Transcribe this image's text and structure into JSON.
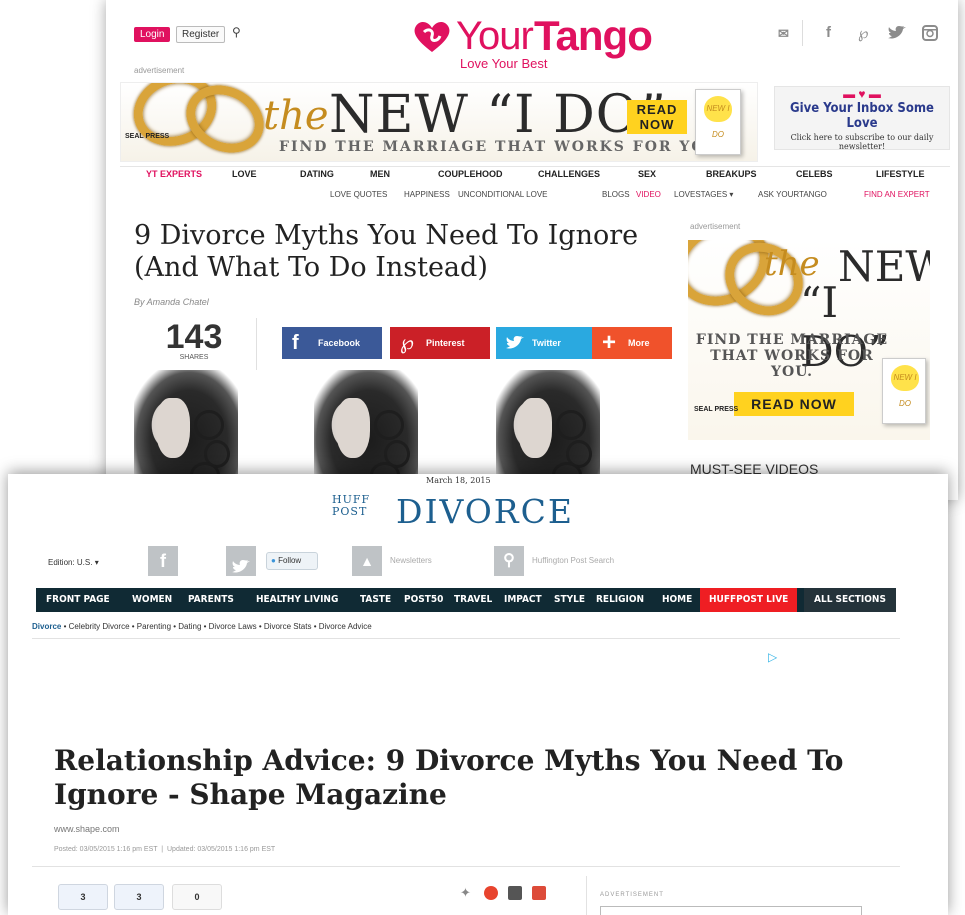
{
  "yourtango": {
    "login": "Login",
    "register": "Register",
    "search_icon": "search-icon",
    "advertisement": "advertisement",
    "logo_your": "Your",
    "logo_tango": "Tango",
    "logo_tagline": "Love Your Best",
    "social_icons": [
      "mail-icon",
      "facebook-icon",
      "pinterest-icon",
      "twitter-icon",
      "instagram-icon"
    ],
    "banner": {
      "the": "the",
      "headline": "NEW “I DO”",
      "subline": "FIND THE MARRIAGE THAT WORKS FOR YOU.",
      "read_now": "READ NOW",
      "book_badge": "NEW I DO",
      "publisher": "SEAL PRESS"
    },
    "inbox": {
      "title": "Give Your Inbox Some Love",
      "subtitle": "Click here to subscribe to our daily newsletter!"
    },
    "nav": [
      "YT EXPERTS",
      "LOVE",
      "DATING",
      "MEN",
      "COUPLEHOOD",
      "CHALLENGES",
      "SEX",
      "BREAKUPS",
      "CELEBS",
      "LIFESTYLE"
    ],
    "subnav": [
      "LOVE QUOTES",
      "HAPPINESS",
      "UNCONDITIONAL LOVE",
      "BLOGS",
      "VIDEO",
      "LOVESTAGES ▾",
      "ASK YOURTANGO",
      "FIND AN EXPERT"
    ],
    "title": "9 Divorce Myths You Need To Ignore (And What To Do Instead)",
    "byline": "By Amanda Chatel",
    "shares_count": "143",
    "shares_label": "SHARES",
    "share_buttons": [
      "Facebook",
      "Pinterest",
      "Twitter",
      "More"
    ],
    "side_ad": {
      "the": "the",
      "new": "NEW",
      "ido": "“I DO”",
      "find": "FIND THE MARRIAGE THAT WORKS FOR YOU.",
      "read_now": "READ NOW",
      "book_badge": "NEW I DO",
      "publisher": "SEAL PRESS"
    },
    "must_see": "MUST-SEE VIDEOS",
    "colors": {
      "brand": "#e0115f",
      "facebook": "#3b5998",
      "pinterest": "#cb2027",
      "twitter": "#2aa9e0",
      "more": "#f0522b",
      "ad_yellow": "#ffd21f",
      "gold": "#d9a43a"
    }
  },
  "huffpost": {
    "date": "March 18, 2015",
    "logo_huff": "HUFF",
    "logo_post": "POST",
    "section": "DIVORCE",
    "edition": "Edition: U.S. ▾",
    "follow": "Follow",
    "newsletters": "Newsletters",
    "search_placeholder": "Huffington Post Search",
    "nav": [
      "FRONT PAGE",
      "WOMEN",
      "PARENTS",
      "HEALTHY LIVING",
      "TASTE",
      "POST50",
      "TRAVEL",
      "IMPACT",
      "STYLE",
      "RELIGION",
      "HOME",
      "HUFFPOST LIVE",
      "ALL SECTIONS"
    ],
    "breadcrumbs": [
      "Divorce",
      "Celebrity Divorce",
      "Parenting",
      "Dating",
      "Divorce Laws",
      "Divorce Stats",
      "Divorce Advice"
    ],
    "title": "Relationship Advice: 9 Divorce Myths You Need To Ignore - Shape Magazine",
    "source": "www.shape.com",
    "posted": "Posted: 03/05/2015 1:16 pm EST",
    "updated": "Updated: 03/05/2015 1:16 pm EST",
    "counts": [
      "3",
      "3",
      "0"
    ],
    "advertisement": "ADVERTISEMENT",
    "colors": {
      "nav_bg": "#102a34",
      "live": "#ef1e23",
      "logo": "#1d5f8f"
    }
  }
}
